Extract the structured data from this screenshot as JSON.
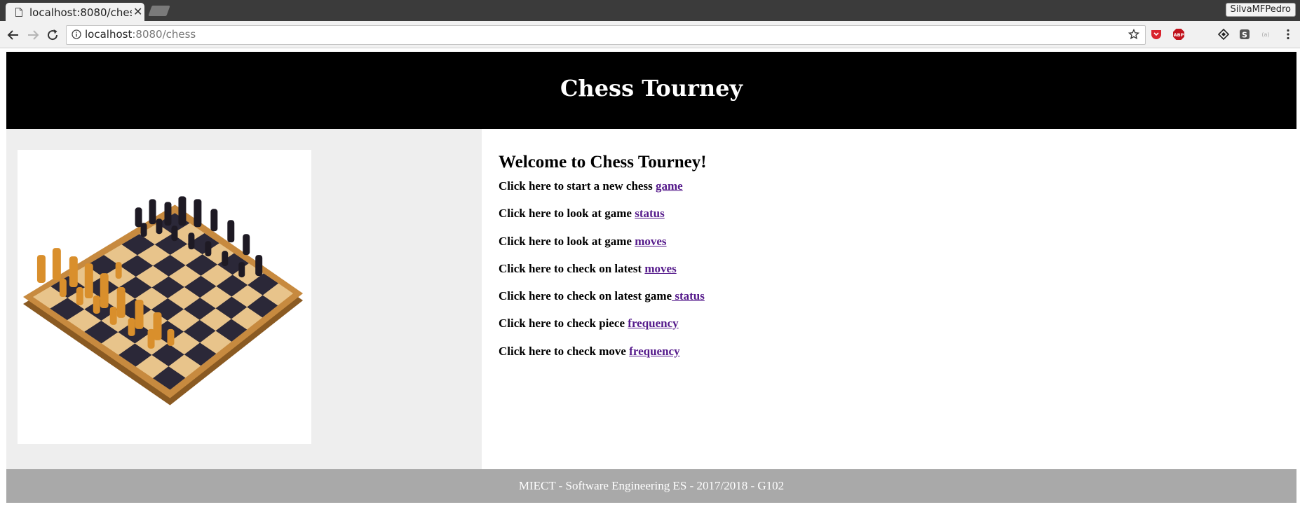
{
  "browser": {
    "tab_title": "localhost:8080/chess",
    "profile_name": "SilvaMFPedro",
    "url_host": "localhost",
    "url_path": ":8080/chess",
    "extensions": [
      "pocket-icon",
      "adblock-icon",
      "extension-icon",
      "diamond-icon",
      "s-icon",
      "translate-icon"
    ]
  },
  "header": {
    "title": "Chess Tourney"
  },
  "main": {
    "welcome": "Welcome to Chess Tourney!",
    "links": [
      {
        "text": "Click here to start a new chess ",
        "link": "game"
      },
      {
        "text": "Click here to look at game ",
        "link": "status"
      },
      {
        "text": "Click here to look at game ",
        "link": "moves"
      },
      {
        "text": "Click here to check on latest ",
        "link": "moves"
      },
      {
        "text": "Click here to check on latest game",
        "link": " status"
      },
      {
        "text": "Click here to check piece ",
        "link": "frequency"
      },
      {
        "text": "Click here to check move ",
        "link": "frequency"
      }
    ]
  },
  "footer": {
    "text": "MIECT - Software Engineering ES - 2017/2018 - G102"
  },
  "colors": {
    "header_bg": "#000000",
    "sidebar_bg": "#eeeeee",
    "footer_bg": "#a9a9a9",
    "link": "#551a8b"
  }
}
